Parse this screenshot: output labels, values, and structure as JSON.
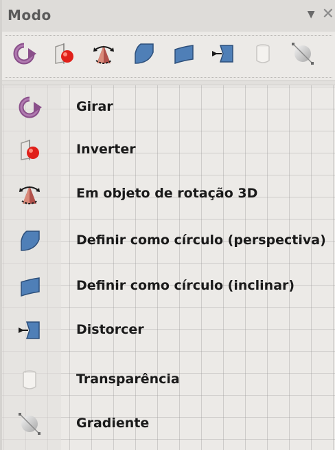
{
  "panel": {
    "title": "Modo",
    "dropdown_symbol": "▼",
    "close_symbol": "✕"
  },
  "toolbar": {
    "buttons": [
      {
        "icon": "rotate-icon",
        "name": "Girar"
      },
      {
        "icon": "flip-icon",
        "name": "Inverter"
      },
      {
        "icon": "3d-rotation-icon",
        "name": "Em objeto de rotação 3D"
      },
      {
        "icon": "circle-perspective-icon",
        "name": "Definir como círculo (perspectiva)"
      },
      {
        "icon": "circle-slant-icon",
        "name": "Definir como círculo (inclinar)"
      },
      {
        "icon": "distort-icon",
        "name": "Distorcer"
      },
      {
        "icon": "transparency-icon",
        "name": "Transparência"
      },
      {
        "icon": "gradient-icon",
        "name": "Gradiente"
      }
    ]
  },
  "items": [
    {
      "label": "Girar",
      "icon": "rotate-icon"
    },
    {
      "label": "Inverter",
      "icon": "flip-icon"
    },
    {
      "label": "Em objeto de rotação 3D",
      "icon": "3d-rotation-icon"
    },
    {
      "label": "Definir como círculo (perspectiva)",
      "icon": "circle-perspective-icon"
    },
    {
      "label": "Definir como círculo (inclinar)",
      "icon": "circle-slant-icon"
    },
    {
      "label": "Distorcer",
      "icon": "distort-icon"
    },
    {
      "label": "Transparência",
      "icon": "transparency-icon"
    },
    {
      "label": "Gradiente",
      "icon": "gradient-icon"
    }
  ],
  "colors": {
    "rotate": "#8a4f8a",
    "flip_red": "#e0201a",
    "shape_blue": "#4f7fb7",
    "shape_dark": "#2d4f7a"
  }
}
